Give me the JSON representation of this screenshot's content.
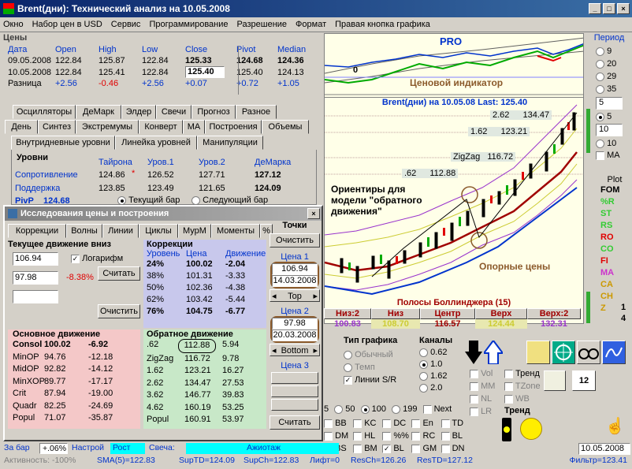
{
  "window": {
    "title": "Brent(дни): Технический анализ на 10.05.2008",
    "min": "_",
    "max": "□",
    "close": "×"
  },
  "menu": [
    "Окно",
    "Набор цен в USD",
    "Сервис",
    "Программирование",
    "Разрешение",
    "Формат",
    "Правая кнопка графика"
  ],
  "prices": {
    "title": "Цены",
    "headers": [
      "Дата",
      "Open",
      "High",
      "Low",
      "Close",
      "Pivot",
      "Median"
    ],
    "rows": [
      [
        "09.05.2008",
        "122.84",
        "125.87",
        "122.84",
        "125.33",
        "124.68",
        "124.36"
      ],
      [
        "10.05.2008",
        "122.84",
        "125.41",
        "122.84",
        "125.40",
        "125.40",
        "124.13"
      ]
    ],
    "diff": [
      "Разница",
      "+2.56",
      "-0.46",
      "+2.56",
      "+0.07",
      "+0.72",
      "+1.05"
    ]
  },
  "tabs_row1": [
    "Осцилляторы",
    "ДеМарк",
    "Элдер",
    "Свечи",
    "Прогноз",
    "Разное"
  ],
  "tabs_row2": [
    "День",
    "Синтез",
    "Экстремумы",
    "Конверт",
    "MA",
    "Построения",
    "Объемы"
  ],
  "tabs_row3": [
    "Внутридневные уровни",
    "Линейка уровней",
    "Манипуляции"
  ],
  "levels": {
    "title": "Уровни",
    "headers": [
      "Тайрона",
      "Уров.1",
      "Уров.2",
      "ДеМарка"
    ],
    "rows": [
      {
        "label": "Сопротивление",
        "vals": [
          "124.86",
          "126.52",
          "127.71",
          "127.12"
        ]
      },
      {
        "label": "Поддержка",
        "vals": [
          "123.85",
          "123.49",
          "121.65",
          "124.09"
        ]
      }
    ],
    "pivp_label": "PivP",
    "pivp_value": "124.68",
    "opt1": "Текущий бар",
    "opt2": "Следующий бар"
  },
  "dialog": {
    "title": "Исследования цены и построения",
    "tabs": [
      "Коррекции",
      "Волны",
      "Линии",
      "Циклы",
      "МурМ",
      "Моменты",
      "%"
    ],
    "current_title": "Текущее движение вниз",
    "cur_high": "106.94",
    "logarithm": "Логарифм",
    "cur_low": "97.98",
    "cur_pct": "-8.38%",
    "calc_btn": "Считать",
    "clear_btn": "Очистить",
    "corr_title": "Коррекции",
    "corr_headers": [
      "Уровень",
      "Цена",
      "Движение"
    ],
    "corr_rows": [
      [
        "24%",
        "100.02",
        "-2.04"
      ],
      [
        "38%",
        "101.31",
        "-3.33"
      ],
      [
        "50%",
        "102.36",
        "-4.38"
      ],
      [
        "62%",
        "103.42",
        "-5.44"
      ],
      [
        "76%",
        "104.75",
        "-6.77"
      ]
    ],
    "main_title": "Основное движение",
    "main_rows": [
      [
        "Consol",
        "100.02",
        "-6.92"
      ],
      [
        "MinOP",
        "94.76",
        "-12.18"
      ],
      [
        "MidOP",
        "92.82",
        "-14.12"
      ],
      [
        "MinXOP",
        "89.77",
        "-17.17"
      ],
      [
        "Crit",
        "87.94",
        "-19.00"
      ],
      [
        "Quadr",
        "82.25",
        "-24.69"
      ],
      [
        "Popul",
        "71.07",
        "-35.87"
      ]
    ],
    "rev_title": "Обратное движение",
    "rev_rows": [
      [
        ".62",
        "112.88",
        "5.94"
      ],
      [
        "ZigZag",
        "116.72",
        "9.78"
      ],
      [
        "1.62",
        "123.21",
        "16.27"
      ],
      [
        "2.62",
        "134.47",
        "27.53"
      ],
      [
        "3.62",
        "146.77",
        "39.83"
      ],
      [
        "4.62",
        "160.19",
        "53.25"
      ],
      [
        "Popul",
        "160.91",
        "53.97"
      ]
    ],
    "points_title": "Точки",
    "points_clear": "Очистить",
    "p1_label": "Цена 1",
    "p1_price": "106.94",
    "p1_date": "14.03.2008",
    "p1_pos": "Top",
    "p2_label": "Цена 2",
    "p2_price": "97.98",
    "p2_date": "20.03.2008",
    "p2_pos": "Bottom",
    "p3_label": "Цена 3",
    "calc2": "Считать"
  },
  "chart": {
    "pro_label": "PRO",
    "zero_label": "0",
    "indicator_label": "Ценовой индикатор",
    "title": "Brent(дни) на 10.05.08   Last: 125.40",
    "annotations": [
      {
        "key": "lvl262",
        "text": "2.62",
        "val": "134.47"
      },
      {
        "key": "lvl162",
        "text": "1.62",
        "val": "123.21"
      },
      {
        "key": "zigzag",
        "text": "ZigZag",
        "val": "116.72"
      },
      {
        "key": "lvl062",
        "text": ".62",
        "val": "112.88"
      }
    ],
    "note": "Ориентиры для модели \"обратного движения\"",
    "support": "Опорные цены"
  },
  "bollinger": {
    "title": "Полосы Боллинджера (15)",
    "headers": [
      "Низ:2",
      "Низ",
      "Центр",
      "Верх",
      "Верх:2"
    ],
    "values": [
      "100.83",
      "108.70",
      "116.57",
      "124.44",
      "132.31"
    ]
  },
  "period": {
    "title": "Период",
    "options": [
      "9",
      "20",
      "29",
      "35",
      "5",
      "10"
    ],
    "selected": "5",
    "field1": "5",
    "field2": "10",
    "ma": "MA"
  },
  "plot": {
    "title": "Plot",
    "items": [
      "FOM",
      "%R",
      "ST",
      "RS",
      "RO",
      "CO",
      "FI",
      "MA",
      "CA",
      "CH",
      "Z"
    ],
    "nums": [
      "1",
      "4"
    ]
  },
  "chart_type": {
    "title": "Тип графика",
    "options": [
      "Обычный",
      "Темп",
      "Линии S/R"
    ]
  },
  "channels": {
    "title": "Каналы",
    "options": [
      "0.62",
      "1.0",
      "1.62",
      "2.0"
    ],
    "selected": "1.0"
  },
  "toggles": {
    "col1": [
      "Vol",
      "MM",
      "NL",
      "LR"
    ],
    "col2": [
      "Тренд",
      "TZone",
      "WB"
    ],
    "trend": "Тренд"
  },
  "bottom_row": {
    "opts": [
      "5",
      "50",
      "100",
      "199"
    ],
    "selected": "100",
    "next": "Next"
  },
  "checkgrid": [
    [
      "BB",
      "KC",
      "DC",
      "En",
      "TD"
    ],
    [
      "DM",
      "HL",
      "%%",
      "RC",
      "BL"
    ],
    [
      "BS",
      "BM",
      "BL",
      "GM",
      "DN"
    ]
  ],
  "date_field": "10.05.2008",
  "status": {
    "r1": [
      "За бар",
      "+.06%",
      "Настрой",
      "Рост",
      "Свеча:",
      "Ажиотаж"
    ],
    "r2": [
      "Активность: -100%",
      "SMA(5)=122.83",
      "SupTD=124.09",
      "SupCh=122.83",
      "Лифт=0",
      "ResCh=126.26",
      "ResTD=127.12",
      "Фильтр=123.41"
    ]
  },
  "colors": {
    "title_bar": "#0a246a",
    "chart_bg": "#ffffe8",
    "accent_blue": "#0033cc",
    "accent_red": "#e00000"
  }
}
